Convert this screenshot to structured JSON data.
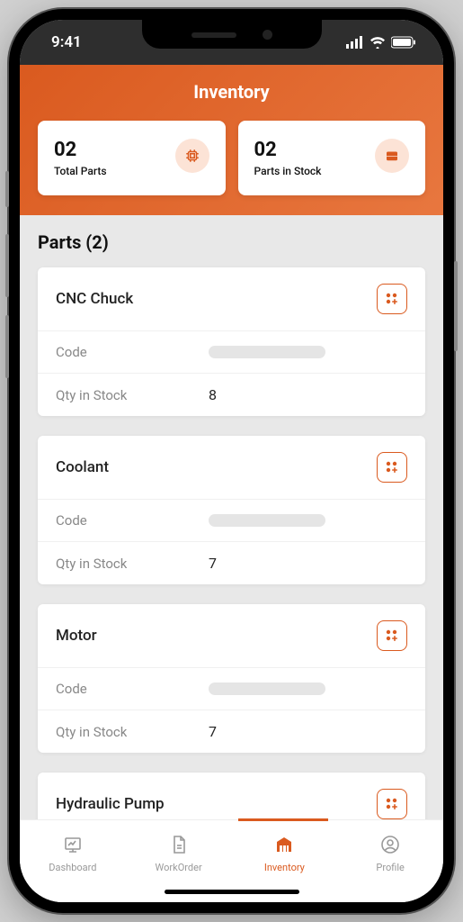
{
  "status": {
    "time": "9:41"
  },
  "header": {
    "title": "Inventory"
  },
  "stats": [
    {
      "value": "02",
      "label": "Total Parts",
      "icon": "chip-icon"
    },
    {
      "value": "02",
      "label": "Parts in Stock",
      "icon": "box-icon"
    }
  ],
  "section": {
    "title": "Parts (2)"
  },
  "labels": {
    "code": "Code",
    "qty": "Qty in Stock"
  },
  "parts": [
    {
      "name": "CNC Chuck",
      "code": "",
      "qty": "8"
    },
    {
      "name": "Coolant",
      "code": "",
      "qty": "7"
    },
    {
      "name": "Motor",
      "code": "",
      "qty": "7"
    },
    {
      "name": "Hydraulic Pump",
      "code": "",
      "qty": ""
    }
  ],
  "nav": [
    {
      "label": "Dashboard",
      "icon": "dashboard-icon",
      "active": false
    },
    {
      "label": "WorkOrder",
      "icon": "workorder-icon",
      "active": false
    },
    {
      "label": "Inventory",
      "icon": "inventory-icon",
      "active": true
    },
    {
      "label": "Profile",
      "icon": "profile-icon",
      "active": false
    }
  ],
  "colors": {
    "accent": "#da5a1f"
  }
}
